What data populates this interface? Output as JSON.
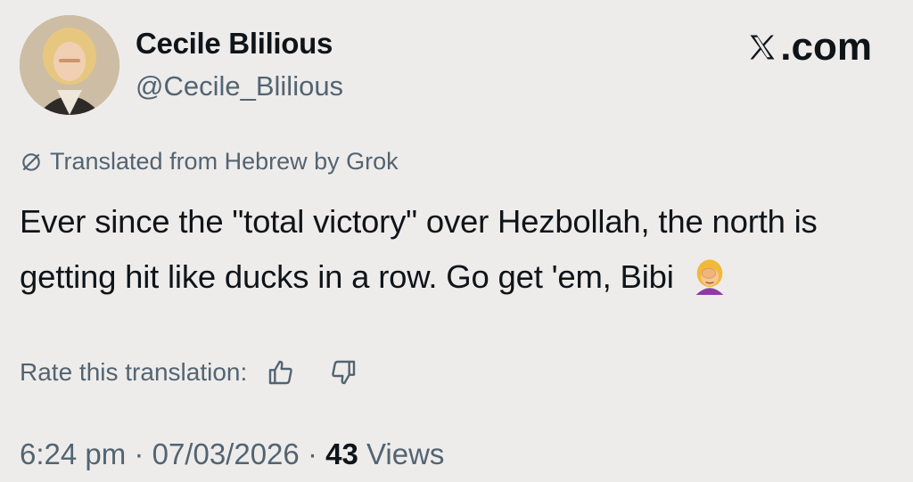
{
  "user": {
    "name": "Cecile Blilious",
    "handle": "@Cecile_Blilious"
  },
  "brand": {
    "label": ".com",
    "icon": "x-logo-icon"
  },
  "translation_notice": "Translated from Hebrew by Grok",
  "tweet": {
    "text": "Ever since the \"total victory\" over Hezbollah, the north is getting hit like ducks in a row. Go get 'em, Bibi",
    "emoji": "woman-facepalming"
  },
  "rating": {
    "label": "Rate this translation:",
    "thumbs_up_icon": "thumbs-up-icon",
    "thumbs_down_icon": "thumbs-down-icon"
  },
  "meta": {
    "time": "6:24 pm",
    "separator": "·",
    "date": "07/03/2026",
    "views_count": "43",
    "views_label": "Views"
  },
  "colors": {
    "background": "#eeeceb",
    "primary_text": "#0f1419",
    "secondary_text": "#536471"
  }
}
